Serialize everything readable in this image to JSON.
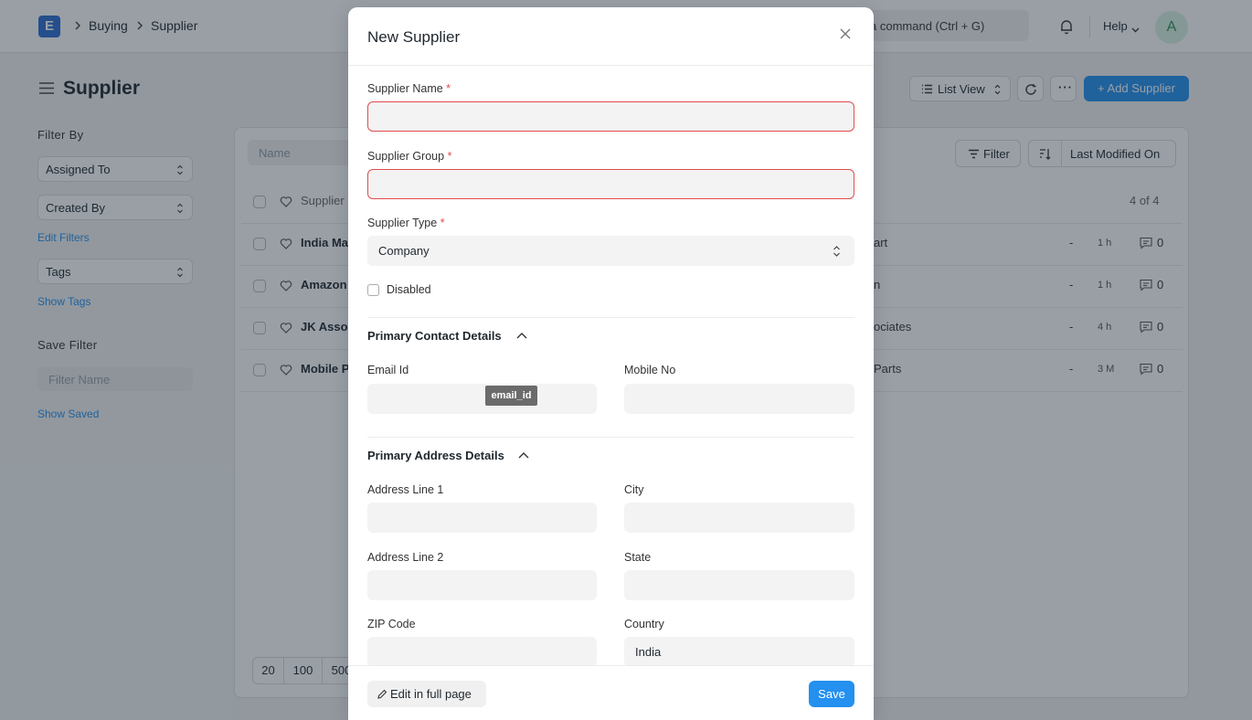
{
  "navbar": {
    "logo_letter": "E",
    "breadcrumbs": [
      "Buying",
      "Supplier"
    ],
    "search_placeholder": "a command (Ctrl + G)",
    "help_label": "Help",
    "avatar_initial": "A"
  },
  "page": {
    "title": "Supplier",
    "list_view_label": "List View",
    "add_button_label": "+ Add Supplier"
  },
  "sidebar": {
    "filter_by_label": "Filter By",
    "assigned_to": "Assigned To",
    "created_by": "Created By",
    "edit_filters": "Edit Filters",
    "tags": "Tags",
    "show_tags": "Show Tags",
    "save_filter_label": "Save Filter",
    "filter_name_placeholder": "Filter Name",
    "show_saved": "Show Saved"
  },
  "list": {
    "name_filter_placeholder": "Name",
    "filter_label": "Filter",
    "sort_label": "Last Modified On",
    "header_label": "Supplier",
    "count": "4 of 4",
    "rows": [
      {
        "name": "India Ma",
        "group": "art",
        "dash": "-",
        "time": "1 h",
        "comments": "0"
      },
      {
        "name": "Amazon",
        "group": "n",
        "dash": "-",
        "time": "1 h",
        "comments": "0"
      },
      {
        "name": "JK Asso",
        "group": "ociates",
        "dash": "-",
        "time": "4 h",
        "comments": "0"
      },
      {
        "name": "Mobile P",
        "group": "Parts",
        "dash": "-",
        "time": "3 M",
        "comments": "0"
      }
    ],
    "page_sizes": [
      "20",
      "100",
      "500"
    ]
  },
  "modal": {
    "title": "New Supplier",
    "fields": {
      "supplier_name_label": "Supplier Name",
      "supplier_group_label": "Supplier Group",
      "supplier_type_label": "Supplier Type",
      "supplier_type_value": "Company",
      "required_mark": "*",
      "disabled_label": "Disabled"
    },
    "contact_section": {
      "title": "Primary Contact Details",
      "email_label": "Email Id",
      "email_tooltip": "email_id",
      "mobile_label": "Mobile No"
    },
    "address_section": {
      "title": "Primary Address Details",
      "address1_label": "Address Line 1",
      "city_label": "City",
      "address2_label": "Address Line 2",
      "state_label": "State",
      "zip_label": "ZIP Code",
      "country_label": "Country",
      "country_value": "India"
    },
    "footer": {
      "edit_full_label": "Edit in full page",
      "save_label": "Save"
    }
  },
  "colors": {
    "primary": "#2490ef",
    "error": "#e24c4c"
  }
}
